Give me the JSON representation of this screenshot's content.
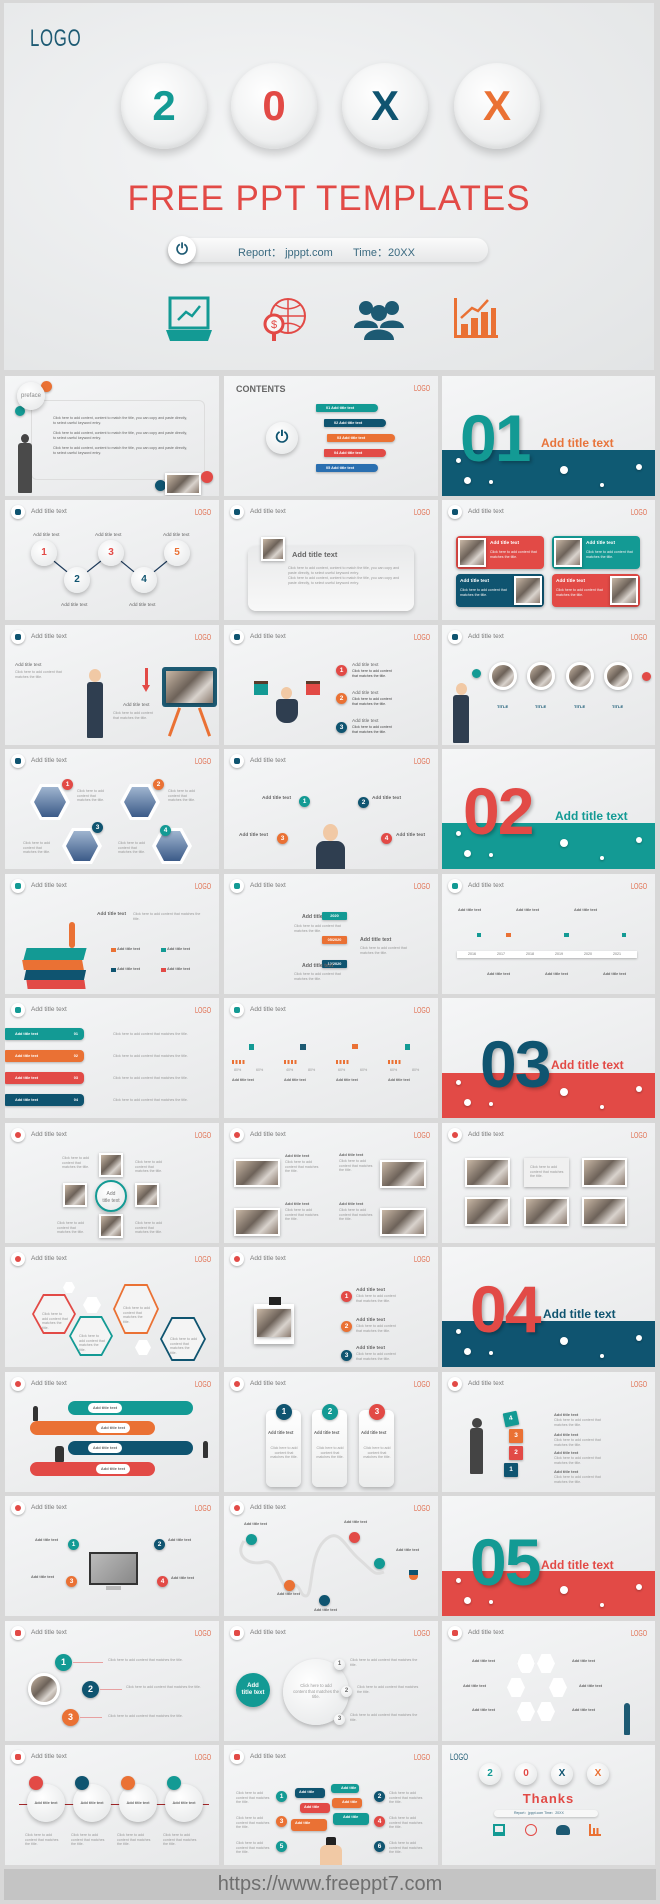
{
  "hero": {
    "logo": "LOGO",
    "digits": [
      "2",
      "0",
      "X",
      "X"
    ],
    "title": "FREE PPT TEMPLATES",
    "report": "Report： jpppt.com",
    "time": "Time：20XX",
    "icons": [
      "laptop-chart-icon",
      "globe-dollar-icon",
      "team-icon",
      "bar-chart-icon"
    ]
  },
  "common": {
    "logo": "LOGO",
    "slide_title": "Add title text",
    "body": "Click here to add content that matches the title.",
    "long_body": "Click here to add content, content to match the title, you can copy and paste directly, to select useful keyword entry.",
    "title_caps": "TITLE",
    "add_title": "Add title",
    "add": "Add",
    "title_text": "title text"
  },
  "preface": {
    "label": "preface"
  },
  "contents": {
    "heading": "CONTENTS",
    "items": [
      "01 Add title text",
      "02 Add title text",
      "03 Add title text",
      "04 Add title text",
      "05 Add title text"
    ]
  },
  "sections": [
    {
      "number": "01",
      "title": "Add title text"
    },
    {
      "number": "02",
      "title": "Add title text"
    },
    {
      "number": "03",
      "title": "Add title text"
    },
    {
      "number": "04",
      "title": "Add title text"
    },
    {
      "number": "05",
      "title": "Add title text"
    }
  ],
  "numbers": [
    "1",
    "2",
    "3",
    "4",
    "5",
    "6"
  ],
  "tabs": [
    "01",
    "02",
    "03",
    "04"
  ],
  "dates": [
    "2020",
    "05/2020",
    "12/2020"
  ],
  "years": [
    "2016",
    "2017",
    "2018",
    "2019",
    "2020",
    "2021"
  ],
  "percents": [
    "80%",
    "60%",
    "40%",
    "80%",
    "60%",
    "60%",
    "60%",
    "80%"
  ],
  "thanks": {
    "digits": [
      "2",
      "0",
      "X",
      "X"
    ],
    "title": "Thanks",
    "report": "Report：jpppt.com  Time：20XX"
  },
  "footer": {
    "url": "https://www.freeppt7.com"
  },
  "colors": {
    "teal": "#139a94",
    "navy": "#0f5470",
    "red": "#e24a46",
    "orange": "#ea7134",
    "background": "#d8d8d8"
  }
}
